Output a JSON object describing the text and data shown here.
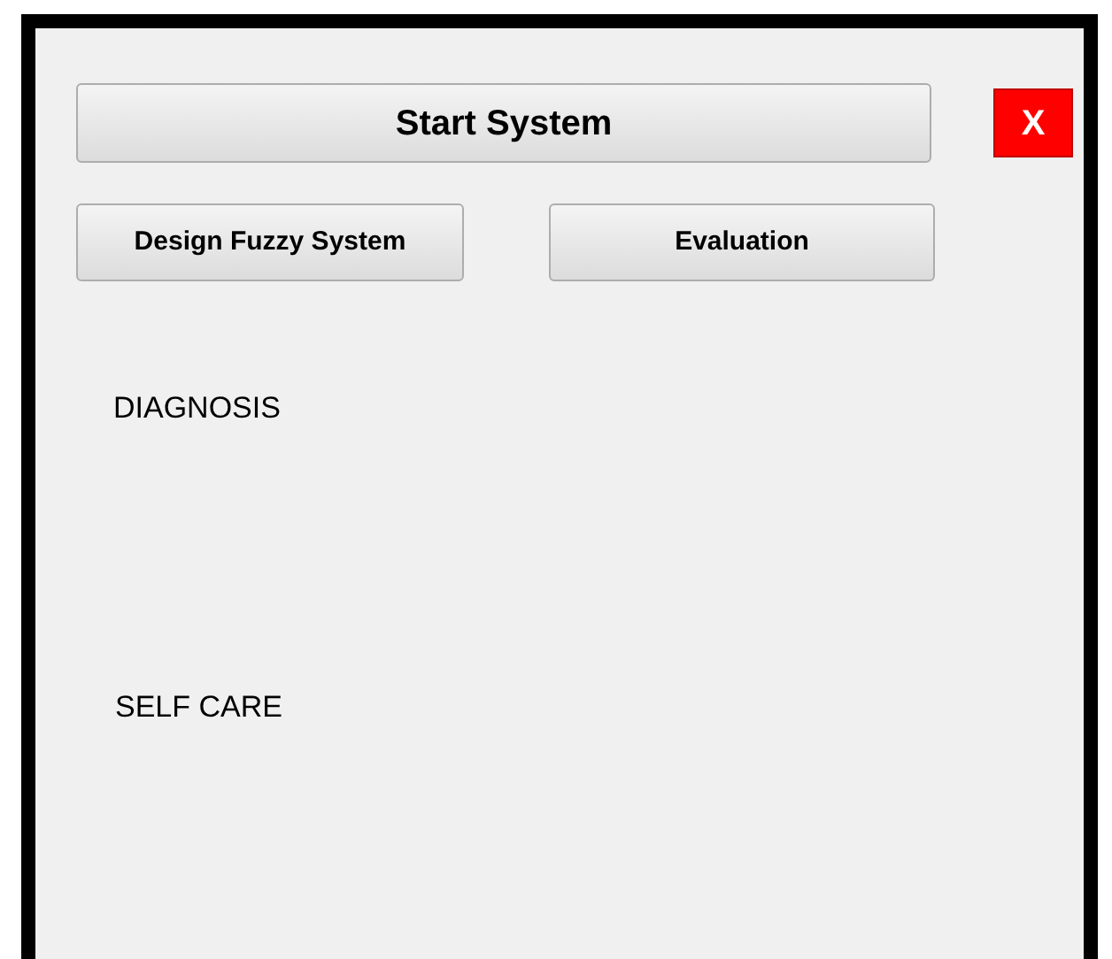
{
  "start_button": {
    "label": "Start System"
  },
  "close_button": {
    "label": "X"
  },
  "buttons": [
    {
      "label": "Design Fuzzy System"
    },
    {
      "label": "Evaluation"
    }
  ],
  "labels": [
    "DIAGNOSIS",
    "SELF CARE"
  ]
}
